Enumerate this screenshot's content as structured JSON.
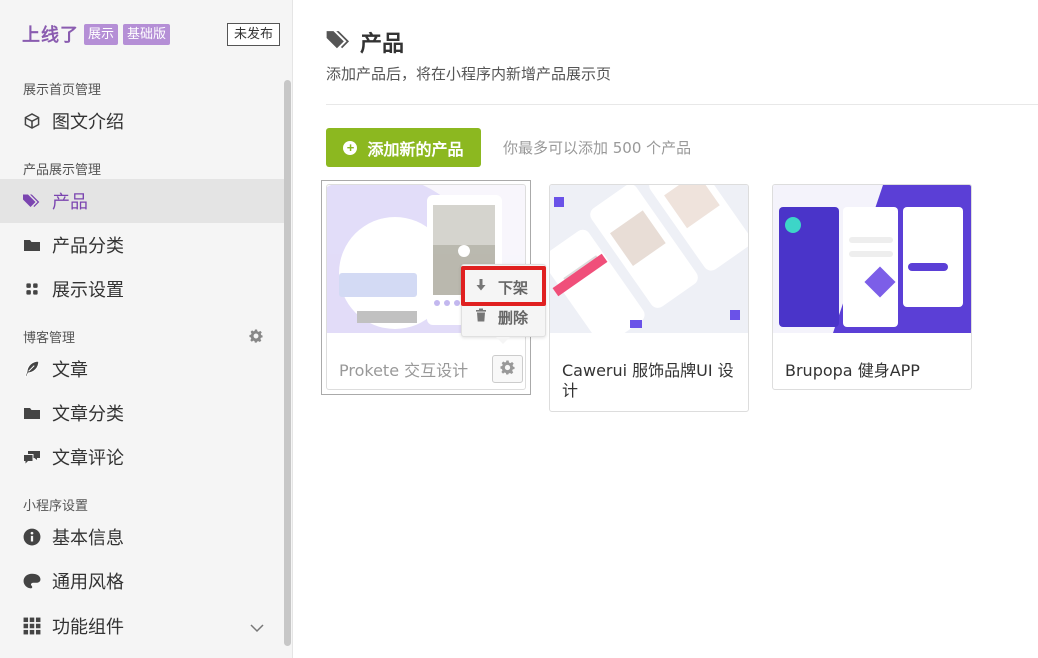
{
  "app": {
    "brand_name": "上线了",
    "tags": [
      "展示",
      "基础版"
    ],
    "publish_status": "未发布"
  },
  "sidebar": {
    "groups": [
      {
        "title": "展示首页管理"
      },
      {
        "title": "产品展示管理"
      },
      {
        "title": "博客管理"
      },
      {
        "title": "小程序设置"
      }
    ],
    "items": [
      {
        "label": "图文介绍",
        "icon": "cube-icon"
      },
      {
        "label": "产品",
        "icon": "tags-icon",
        "active": true
      },
      {
        "label": "产品分类",
        "icon": "folder-icon"
      },
      {
        "label": "展示设置",
        "icon": "grid-icon"
      },
      {
        "label": "文章",
        "icon": "feather-icon"
      },
      {
        "label": "文章分类",
        "icon": "folder-icon"
      },
      {
        "label": "文章评论",
        "icon": "comments-icon"
      },
      {
        "label": "基本信息",
        "icon": "info-icon"
      },
      {
        "label": "通用风格",
        "icon": "palette-icon"
      },
      {
        "label": "功能组件",
        "icon": "apps-icon"
      }
    ]
  },
  "main": {
    "title": "产品",
    "subtitle": "添加产品后，将在小程序内新增产品展示页",
    "add_button": "添加新的产品",
    "limit_hint": "你最多可以添加 500 个产品"
  },
  "products": [
    {
      "name": "Prokete 交互设计",
      "status": "selected"
    },
    {
      "name": "Cawerui 服饰品牌UI 设计"
    },
    {
      "name": "Brupopa 健身APP"
    }
  ],
  "product_menu": {
    "items": [
      "下架",
      "删除"
    ]
  },
  "colors": {
    "brand": "#8a5cb0",
    "accent_green": "#8cb820",
    "active_purple": "#7b45b0",
    "highlight_red": "#e02020"
  }
}
